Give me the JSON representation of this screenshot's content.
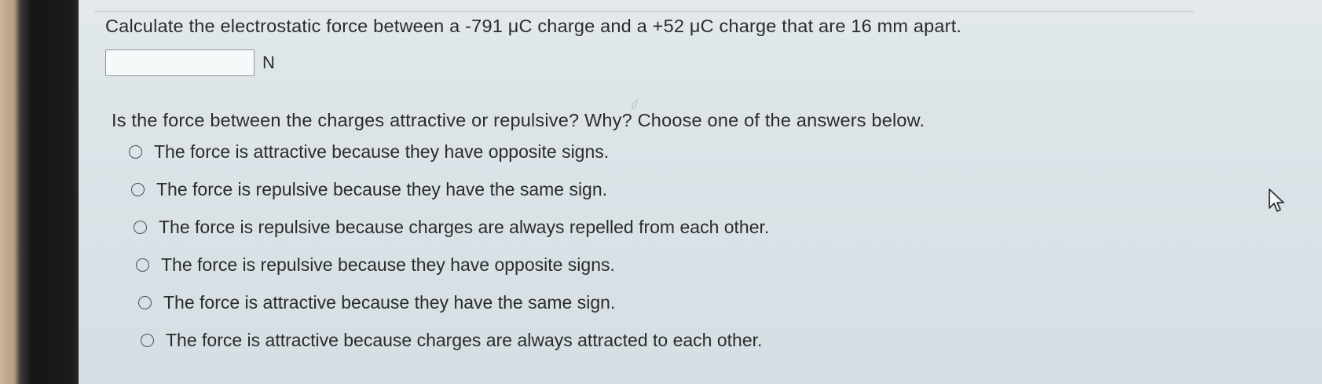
{
  "question": {
    "text": "Calculate the electrostatic force between a -791 μC charge and a +52 μC charge that are 16 mm apart.",
    "answer_value": "",
    "unit": "N"
  },
  "prompt": "Is the force between the charges attractive or repulsive? Why? Choose one of the answers below.",
  "options": [
    "The force is attractive because they have opposite signs.",
    "The force is repulsive because they have the same sign.",
    "The force is repulsive because charges are always repelled from each other.",
    "The force is repulsive because they have opposite signs.",
    "The force is attractive because they have the same sign.",
    "The force is attractive because charges are always attracted to each other."
  ],
  "icons": {
    "cursor": "mouse-pointer-icon",
    "radio": "radio-unselected-icon"
  }
}
